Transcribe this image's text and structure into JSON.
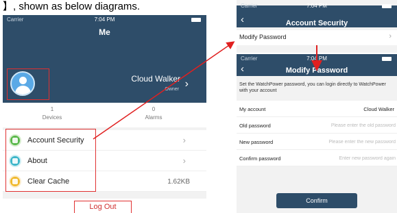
{
  "caption": "】, shown as below diagrams.",
  "me_screen": {
    "status": {
      "carrier": "Carrier",
      "time": "7:04 PM"
    },
    "title": "Me",
    "user": {
      "name": "Cloud Walker",
      "role": "Owner"
    },
    "stats": [
      {
        "value": "1",
        "label": "Devices"
      },
      {
        "value": "0",
        "label": "Alarms"
      }
    ],
    "menu": [
      {
        "label": "Account Security",
        "icon": "shield-icon",
        "color": "#59b84a"
      },
      {
        "label": "About",
        "icon": "info-icon",
        "color": "#3db6c9"
      },
      {
        "label": "Clear Cache",
        "icon": "broom-icon",
        "color": "#f0b92d",
        "value": "1.62KB"
      }
    ],
    "logout_label": "Log Out"
  },
  "account_security_screen": {
    "status": {
      "carrier": "Carrier",
      "time": "7:04 PM"
    },
    "title": "Account Security",
    "rows": [
      {
        "label": "Modify Password"
      }
    ]
  },
  "modify_password_screen": {
    "status": {
      "carrier": "Carrier",
      "time": "7:04 PM"
    },
    "title": "Modify Password",
    "description": "Set the WatchPower password, you can login directly to WatchPower with your account",
    "fields": {
      "account": {
        "label": "My account",
        "value": "Cloud Walker"
      },
      "old_password": {
        "label": "Old password",
        "placeholder": "Please enter the old password"
      },
      "new_password": {
        "label": "New password",
        "placeholder": "Please enter the new password"
      },
      "confirm_password": {
        "label": "Confirm password",
        "placeholder": "Enter new password again"
      }
    },
    "confirm_label": "Confirm"
  },
  "colors": {
    "header": "#2e4d69",
    "highlight": "#e03030",
    "background": "#f2f2f2"
  }
}
